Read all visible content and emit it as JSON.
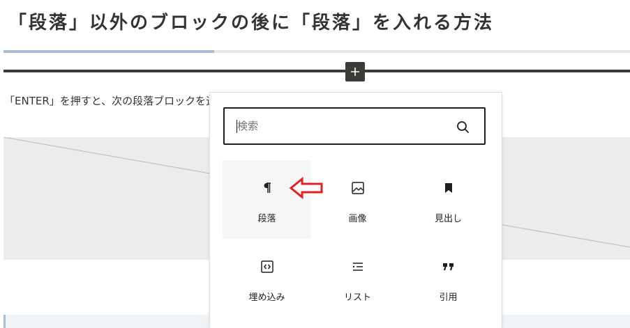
{
  "heading": {
    "title": "「段落」以外のブロックの後に「段落」を入れる方法"
  },
  "colors": {
    "accent": "#a9bfd1",
    "inserter_dark": "#3d3b37",
    "arrow_red": "#e02020"
  },
  "inserter_button": {
    "icon": "plus-icon"
  },
  "paragraph": {
    "text": "「ENTER」を押すと、次の段落ブロックを追加します。"
  },
  "inserter": {
    "search": {
      "value": "",
      "placeholder": "検索",
      "icon": "search-icon"
    },
    "blocks": [
      {
        "label": "段落",
        "icon": "paragraph-icon",
        "active": true
      },
      {
        "label": "画像",
        "icon": "image-icon",
        "active": false
      },
      {
        "label": "見出し",
        "icon": "heading-bookmark-icon",
        "active": false
      },
      {
        "label": "埋め込み",
        "icon": "embed-icon",
        "active": false
      },
      {
        "label": "リスト",
        "icon": "list-icon",
        "active": false
      },
      {
        "label": "引用",
        "icon": "quote-icon",
        "active": false
      }
    ]
  },
  "annotation": {
    "icon": "red-arrow-icon"
  }
}
